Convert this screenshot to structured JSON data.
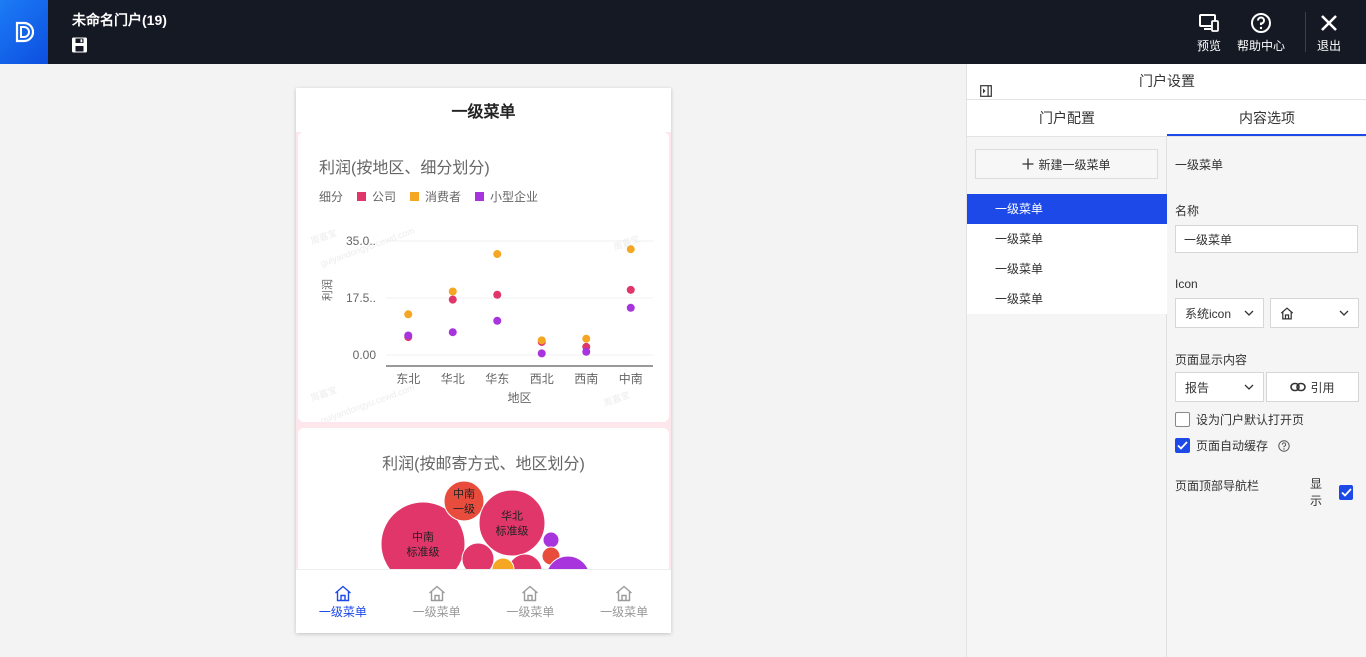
{
  "topbar": {
    "title": "未命名门户(19)",
    "preview_label": "预览",
    "help_label": "帮助中心",
    "exit_label": "退出"
  },
  "phone": {
    "header_title": "一级菜单",
    "card1": {
      "title": "利润(按地区、细分划分)",
      "legend_title": "细分"
    },
    "card2": {
      "title": "利润(按邮寄方式、地区划分)"
    },
    "watermark": [
      "周嘉宝",
      "guiyandongyu.cewd.com"
    ],
    "tabbar": [
      {
        "label": "一级菜单",
        "icon": "home-icon",
        "active": true
      },
      {
        "label": "一级菜单",
        "icon": "home-icon",
        "active": false
      },
      {
        "label": "一级菜单",
        "icon": "home-icon",
        "active": false
      },
      {
        "label": "一级菜单",
        "icon": "home-icon",
        "active": false
      }
    ]
  },
  "chart_data": [
    {
      "type": "scatter",
      "title": "利润(按地区、细分划分)",
      "xlabel": "地区",
      "ylabel": "利润",
      "categories": [
        "东北",
        "华北",
        "华东",
        "西北",
        "西南",
        "中南"
      ],
      "y_ticks": [
        "0.00",
        "17.5..",
        "35.0.."
      ],
      "ylim": [
        -3,
        35
      ],
      "legend_title": "细分",
      "legend": "top-left",
      "grid": true,
      "series": [
        {
          "name": "公司",
          "color": "#e0366a",
          "values": [
            5.5,
            17,
            18.5,
            4,
            2.5,
            20
          ]
        },
        {
          "name": "消费者",
          "color": "#f5a623",
          "values": [
            12.5,
            19.5,
            31,
            4.5,
            5,
            32.5
          ]
        },
        {
          "name": "小型企业",
          "color": "#a834de",
          "values": [
            6,
            7,
            10.5,
            0.5,
            1,
            14.5
          ]
        }
      ]
    },
    {
      "type": "bubble",
      "title": "利润(按邮寄方式、地区划分)",
      "bubbles": [
        {
          "label": [
            "中南",
            "标准级"
          ],
          "color": "#e0366a"
        },
        {
          "label": [
            "中南",
            "一级"
          ],
          "color": "#e84c3d"
        },
        {
          "label": [
            "华北",
            "标准级"
          ],
          "color": "#e0366a"
        },
        {
          "label": [],
          "color": "#a834de"
        },
        {
          "label": [],
          "color": "#e84c3d"
        },
        {
          "label": [],
          "color": "#e0366a"
        },
        {
          "label": [],
          "color": "#e0366a"
        },
        {
          "label": [],
          "color": "#f5a623"
        },
        {
          "label": [],
          "color": "#a834de"
        }
      ]
    }
  ],
  "panel": {
    "title": "门户设置",
    "tabs": [
      {
        "label": "门户配置",
        "active": false
      },
      {
        "label": "内容选项",
        "active": true
      }
    ],
    "new_menu_label": "新建一级菜单",
    "menus": [
      {
        "label": "一级菜单",
        "active": true
      },
      {
        "label": "一级菜单",
        "active": false
      },
      {
        "label": "一级菜单",
        "active": false
      },
      {
        "label": "一级菜单",
        "active": false
      }
    ],
    "form": {
      "section_title": "一级菜单",
      "name_label": "名称",
      "name_value": "一级菜单",
      "icon_label": "Icon",
      "icon_type": "系统icon",
      "icon_value": "home-icon",
      "content_label": "页面显示内容",
      "content_type": "报告",
      "cite_label": "引用",
      "default_open_label": "设为门户默认打开页",
      "default_open": false,
      "auto_cache_label": "页面自动缓存",
      "auto_cache": true,
      "top_nav_label": "页面顶部导航栏",
      "show_label": "显示",
      "show": true
    }
  },
  "colors": {
    "topbar_bg": "#141923",
    "accent": "#1c49e8",
    "company": "#e0366a",
    "consumer": "#f5a623",
    "small_business": "#a834de"
  }
}
